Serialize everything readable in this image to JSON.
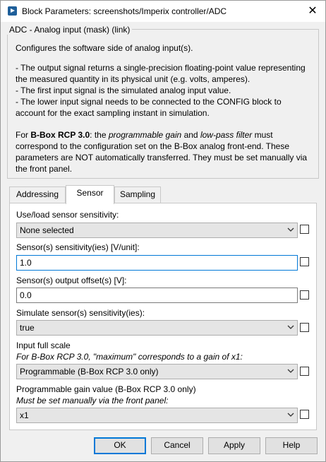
{
  "window": {
    "title": "Block Parameters: screenshots/Imperix controller/ADC",
    "close_glyph": "✕"
  },
  "mask": {
    "group_title": "ADC - Analog input (mask) (link)",
    "summary": "Configures the software side of analog input(s).",
    "bullets": [
      "- The output signal returns a single-precision floating-point value representing",
      "the measured quantity in its physical unit (e.g. volts, amperes).",
      "- The first input signal is the simulated analog input value.",
      "- The lower input signal needs to be connected to the CONFIG block to",
      "account for the exact sampling instant in simulation."
    ],
    "note": {
      "prefix": "For ",
      "bold": "B-Box RCP 3.0",
      "mid1": ": the ",
      "italic1": "programmable gain",
      "mid2": " and ",
      "italic2": "low-pass filter",
      "suffix": " must",
      "line2": "correspond to the configuration set on the B-Box analog front-end. These",
      "line3": "parameters are NOT automatically transferred. They must be set manually via",
      "line4": "the front panel."
    }
  },
  "tabs": [
    {
      "label": "Addressing",
      "active": false
    },
    {
      "label": "Sensor",
      "active": true
    },
    {
      "label": "Sampling",
      "active": false
    }
  ],
  "params": {
    "sensitivity_mode": {
      "label": "Use/load sensor sensitivity:",
      "value": "None selected",
      "checked": false
    },
    "sensitivity": {
      "label": "Sensor(s) sensitivity(ies) [V/unit]:",
      "value": "1.0",
      "checked": false
    },
    "offset": {
      "label": "Sensor(s) output offset(s) [V]:",
      "value": "0.0",
      "checked": false
    },
    "simulate": {
      "label": "Simulate sensor(s) sensitivity(ies):",
      "value": "true",
      "checked": false
    },
    "full_scale": {
      "label": "Input full scale",
      "hint": "For B-Box RCP 3.0, \"maximum\" corresponds to a gain of x1:",
      "value": "Programmable (B-Box RCP 3.0 only)",
      "checked": false
    },
    "gain": {
      "label": "Programmable gain value (B-Box RCP 3.0 only)",
      "hint": "Must be set manually via the front panel:",
      "value": "x1",
      "checked": false
    }
  },
  "buttons": {
    "ok": "OK",
    "cancel": "Cancel",
    "apply": "Apply",
    "help": "Help"
  },
  "colors": {
    "focus": "#0078d7",
    "window_bg": "#f0f0f0",
    "icon_blue": "#1f5f9a"
  },
  "icons": {
    "app": "simulink-block-icon",
    "close": "close-icon",
    "dropdown": "chevron-down-icon"
  }
}
